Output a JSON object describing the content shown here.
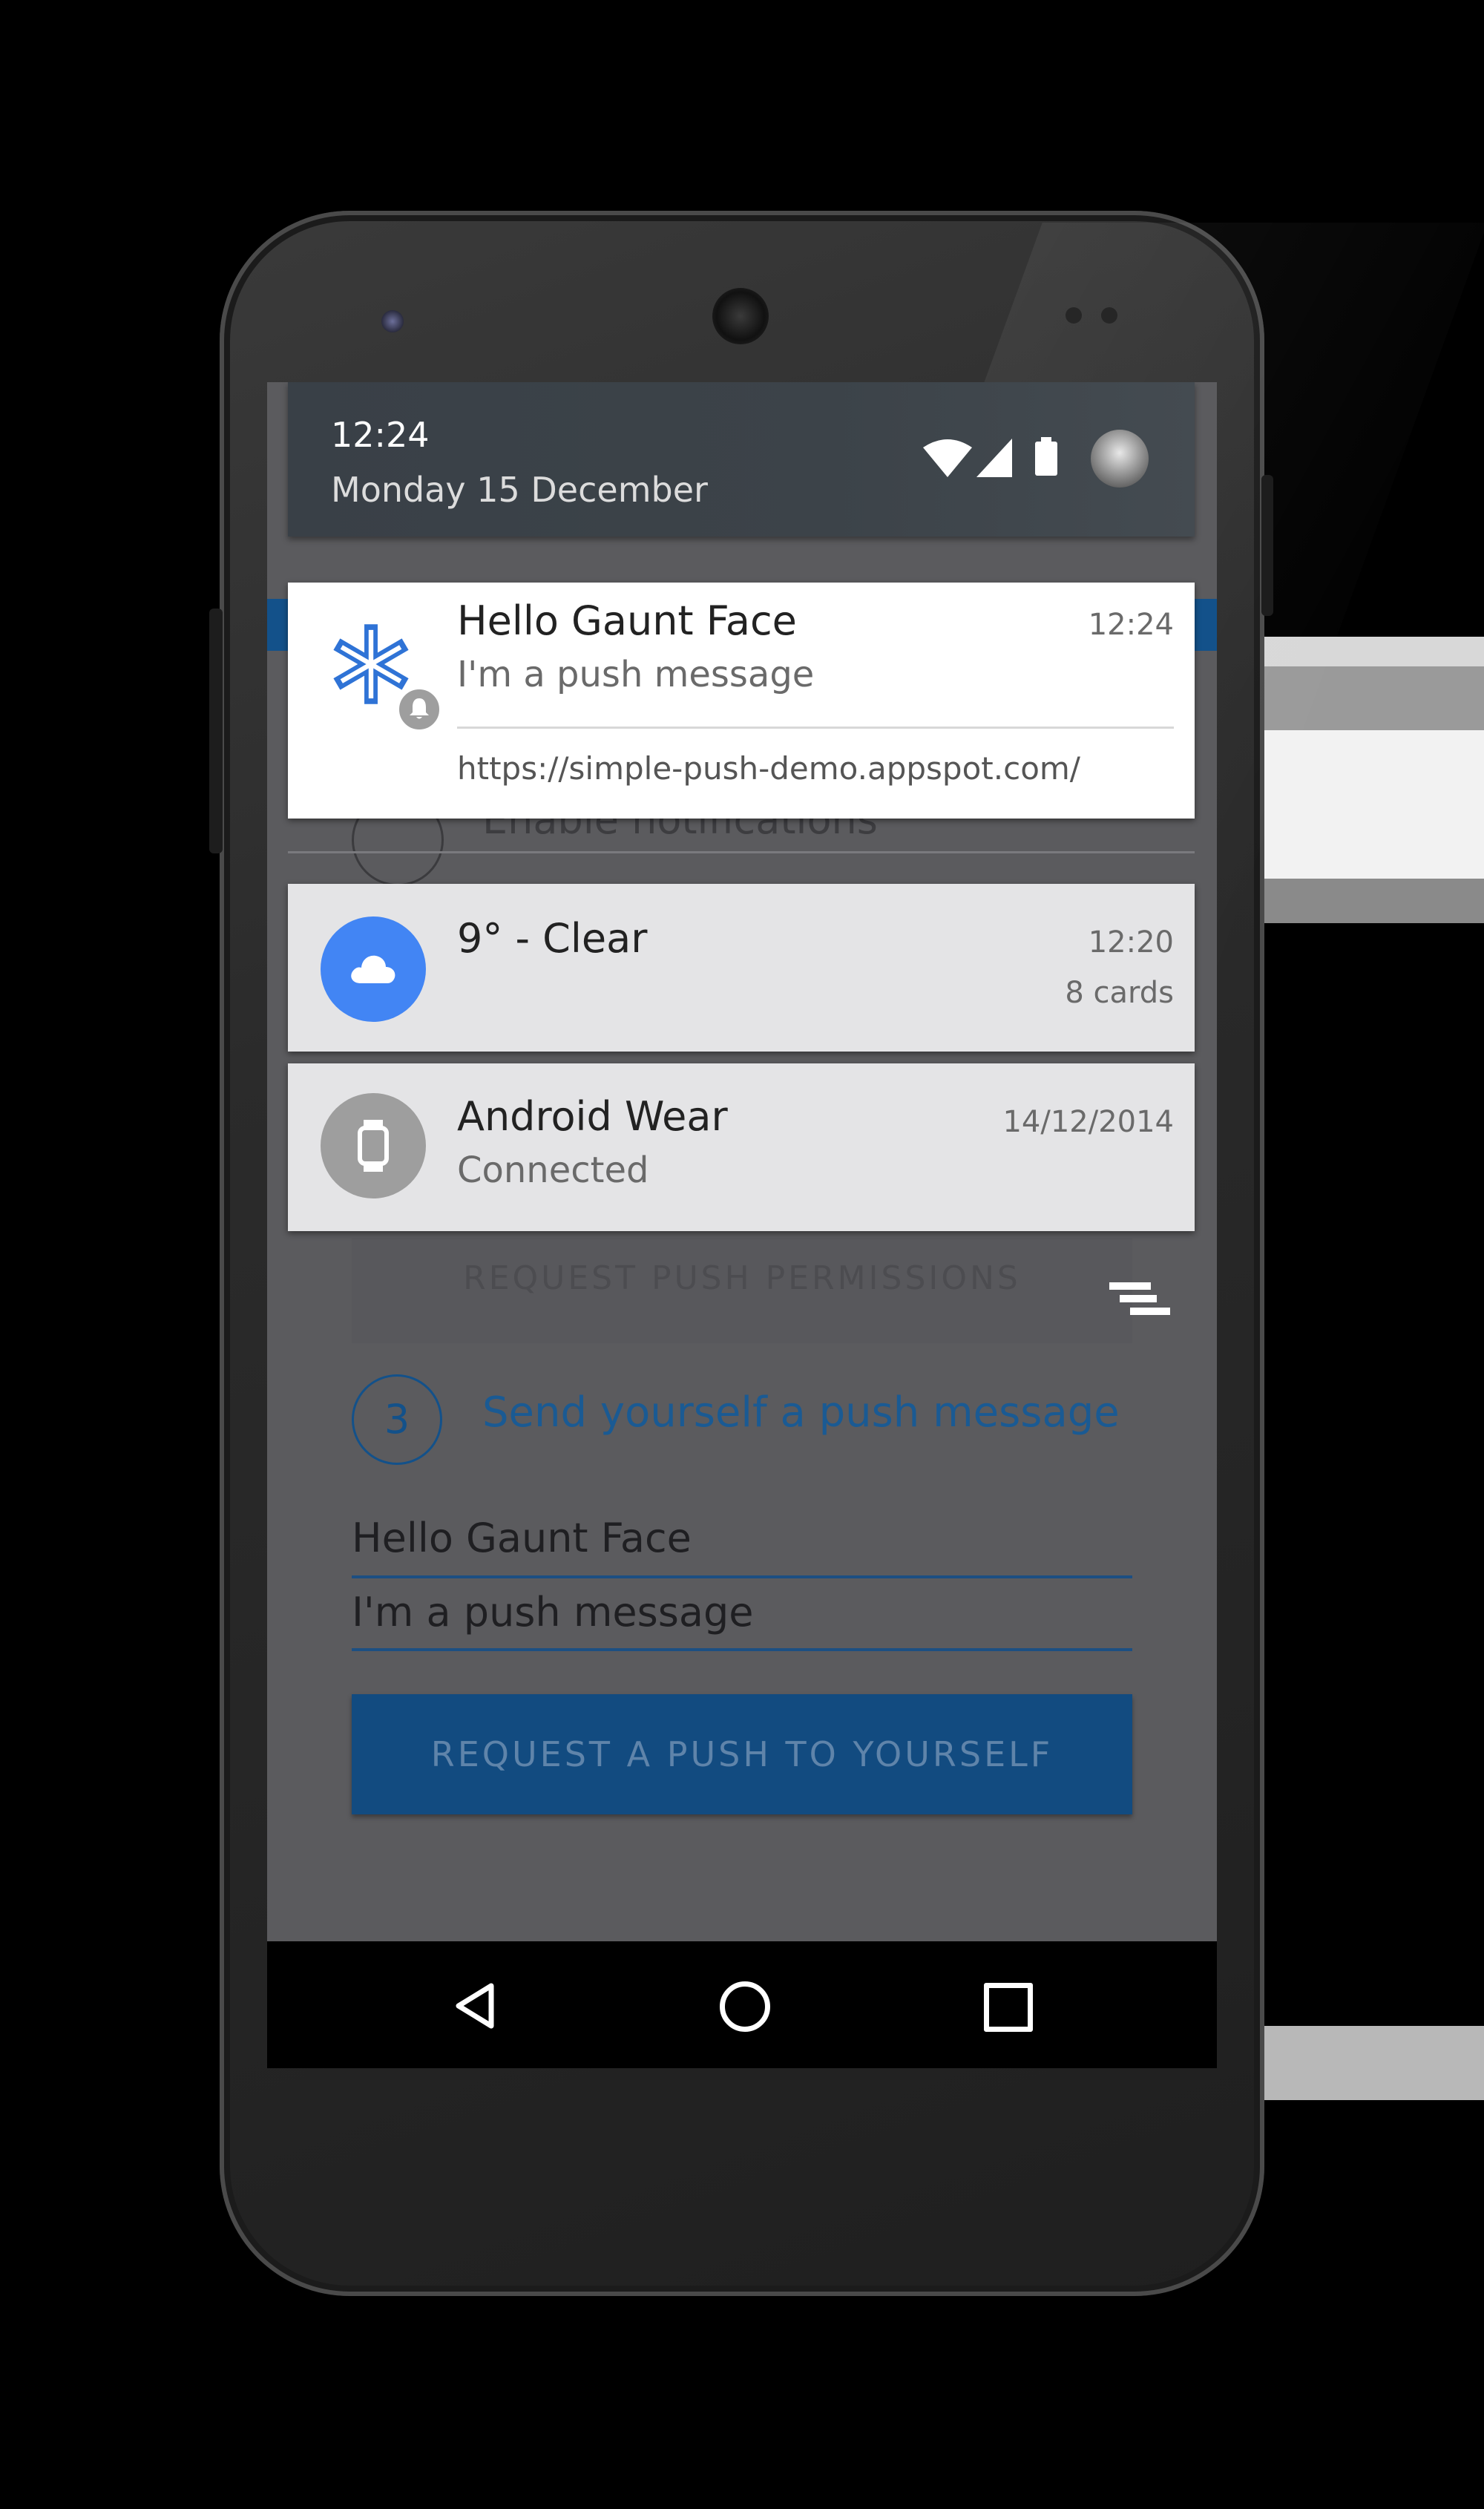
{
  "status": {
    "time": "12:24",
    "date": "Monday 15 December"
  },
  "notifications": [
    {
      "title": "Hello Gaunt Face",
      "message": "I'm a push message",
      "time": "12:24",
      "url": "https://simple-push-demo.appspot.com/",
      "icon": "asterisk-icon",
      "badge_icon": "bell-icon"
    },
    {
      "title": "9° - Clear",
      "time": "12:20",
      "meta": "8 cards",
      "icon": "cloud-icon",
      "icon_color": "#4285f4"
    },
    {
      "title": "Android Wear",
      "message": "Connected",
      "time": "14/12/2014",
      "icon": "watch-icon",
      "icon_color": "#9e9e9e"
    }
  ],
  "page": {
    "step1_label": "Enable notifications",
    "permissions_button": "REQUEST PUSH PERMISSIONS",
    "step3_number": "3",
    "step3_label": "Send yourself a push message",
    "title_field_value": "Hello Gaunt Face",
    "message_field_value": "I'm a push message",
    "push_button": "REQUEST A PUSH TO YOURSELF"
  },
  "colors": {
    "accent": "#13518a",
    "screen_overlay": "#5b5b5e"
  }
}
